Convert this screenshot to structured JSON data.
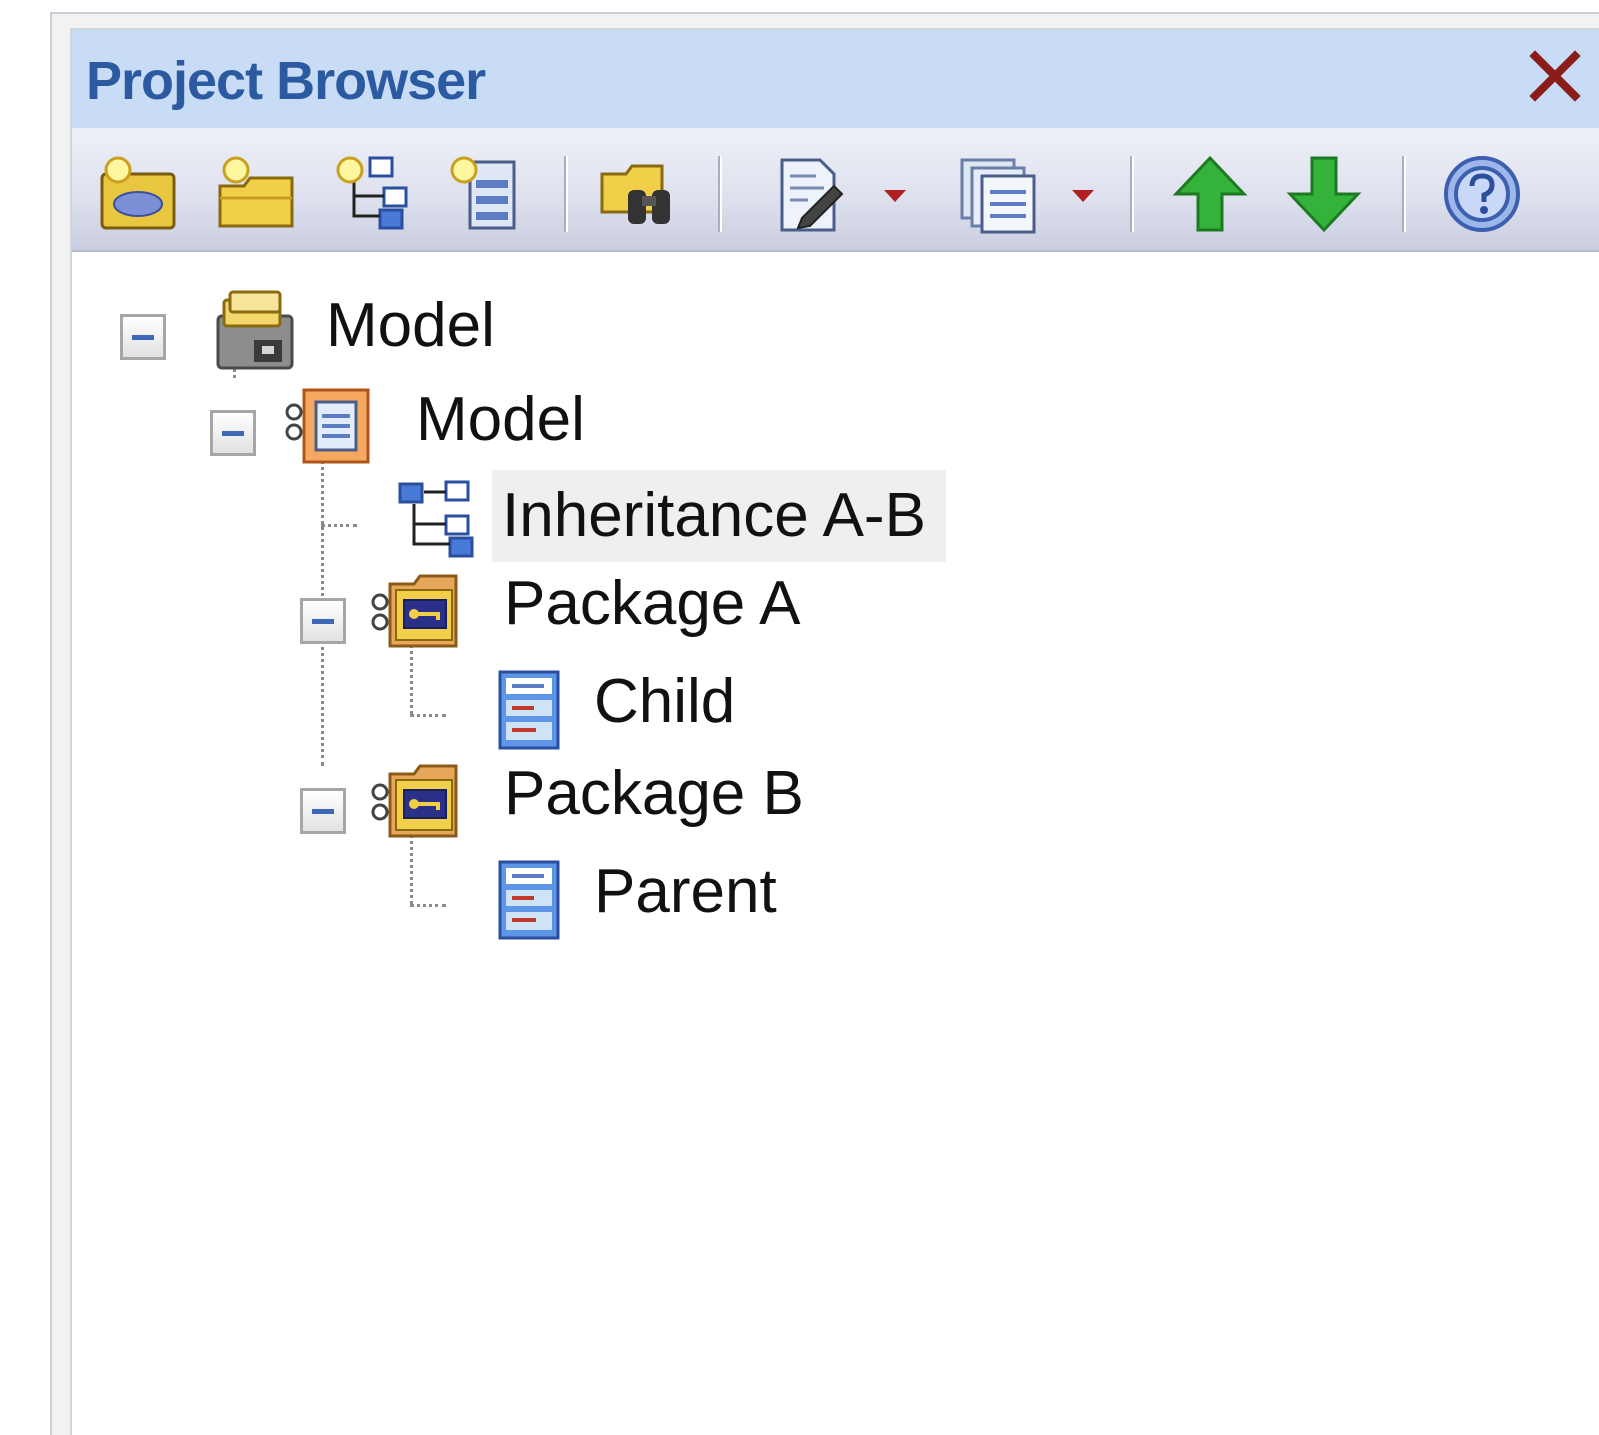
{
  "window": {
    "title": "Project Browser",
    "close_icon": "close-icon"
  },
  "toolbar": {
    "buttons": [
      {
        "name": "new-model-button",
        "icon": "new-model-icon"
      },
      {
        "name": "new-package-button",
        "icon": "new-package-icon"
      },
      {
        "name": "new-diagram-button",
        "icon": "new-diagram-icon"
      },
      {
        "name": "new-element-button",
        "icon": "new-element-icon"
      },
      {
        "name": "find-button",
        "icon": "binoculars-icon"
      },
      {
        "name": "documentation-button",
        "icon": "document-edit-icon"
      },
      {
        "name": "package-control-button",
        "icon": "stacked-docs-icon"
      },
      {
        "name": "move-up-button",
        "icon": "arrow-up-icon"
      },
      {
        "name": "move-down-button",
        "icon": "arrow-down-icon"
      },
      {
        "name": "help-button",
        "icon": "help-icon"
      }
    ],
    "colors": {
      "up_arrow": "#33b33a",
      "down_arrow": "#33b33a",
      "dropdown": "#b02020"
    }
  },
  "tree": {
    "nodes": [
      {
        "label": "Model",
        "icon": "database-root-icon",
        "expanded": true
      },
      {
        "label": "Model",
        "icon": "model-package-icon",
        "expanded": true
      },
      {
        "label": "Inheritance A-B",
        "icon": "class-diagram-icon",
        "selected": true
      },
      {
        "label": "Package A",
        "icon": "package-folder-icon",
        "expanded": true
      },
      {
        "label": "Child",
        "icon": "class-element-icon"
      },
      {
        "label": "Package B",
        "icon": "package-folder-icon",
        "expanded": true
      },
      {
        "label": "Parent",
        "icon": "class-element-icon"
      }
    ]
  }
}
